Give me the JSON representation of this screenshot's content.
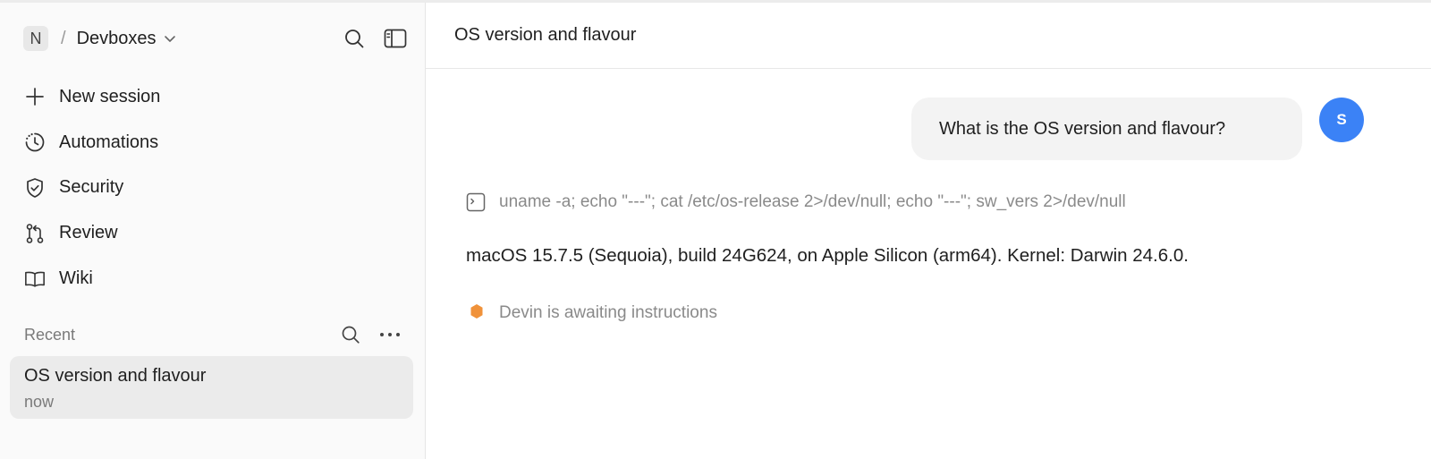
{
  "workspace": {
    "initial": "N",
    "separator": "/",
    "name": "Devboxes",
    "icons": {
      "dropdown": "chevron-down-icon",
      "search": "search-icon",
      "sidebar_toggle": "sidebar-toggle-icon"
    }
  },
  "sidebar": {
    "items": [
      {
        "label": "New session",
        "icon": "plus-icon"
      },
      {
        "label": "Automations",
        "icon": "clock-icon"
      },
      {
        "label": "Security",
        "icon": "shield-check-icon"
      },
      {
        "label": "Review",
        "icon": "git-pull-request-icon"
      },
      {
        "label": "Wiki",
        "icon": "book-icon"
      }
    ],
    "recent": {
      "label": "Recent",
      "items": [
        {
          "title": "OS version and flavour",
          "time": "now"
        }
      ]
    }
  },
  "main": {
    "title": "OS version and flavour",
    "messages": {
      "user": {
        "avatar_initial": "S",
        "text": "What is the OS version and flavour?"
      },
      "command": {
        "icon": "terminal-icon",
        "text": "uname -a; echo \"---\"; cat /etc/os-release 2>/dev/null; echo \"---\"; sw_vers 2>/dev/null"
      },
      "answer": "macOS 15.7.5 (Sequoia), build 24G624, on Apple Silicon (arm64). Kernel: Darwin 24.6.0.",
      "status": {
        "icon": "hexagon-icon",
        "text": "Devin is awaiting instructions"
      }
    }
  },
  "colors": {
    "accent_user_avatar": "#3b82f6",
    "status_dot": "#f0923a",
    "sidebar_bg": "#fafafa",
    "selected_item_bg": "#ebebeb",
    "bubble_bg": "#f3f3f3"
  }
}
